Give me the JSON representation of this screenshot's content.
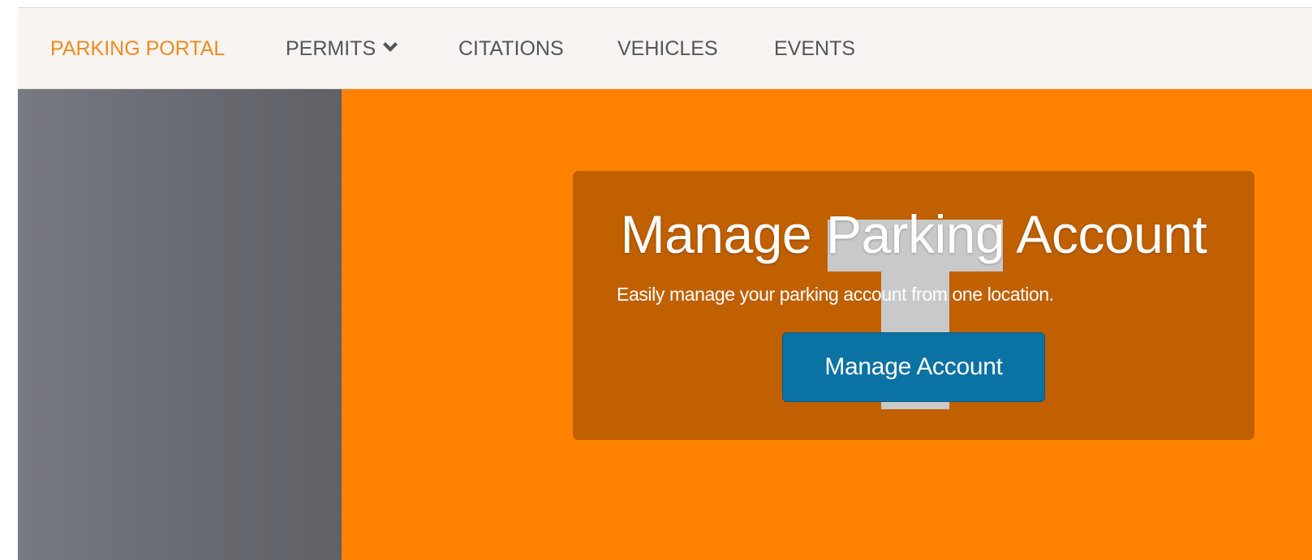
{
  "nav": {
    "brand": "PARKING PORTAL",
    "permits": "PERMITS",
    "citations": "CITATIONS",
    "vehicles": "VEHICLES",
    "events": "EVENTS",
    "permits_icon": "chevron-down-icon"
  },
  "hero": {
    "title": "Manage Parking Account",
    "subtitle": "Easily manage your parking account from one location.",
    "button_label": "Manage Account",
    "logo_icon": "power-t-logo"
  },
  "colors": {
    "brand_orange": "#f08a1e",
    "hero_orange": "#ff8200",
    "card_background": "#c06000",
    "button_blue": "#0b72a4",
    "nav_background": "#f7f4f2",
    "side_panel_gray": "#6a6d73"
  }
}
